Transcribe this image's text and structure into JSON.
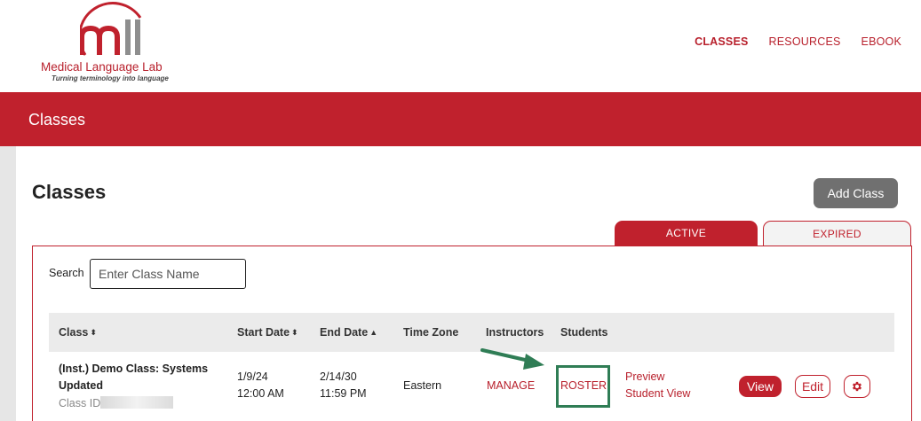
{
  "brand": {
    "name": "Medical Language Lab",
    "tagline": "Turning terminology into language",
    "primary_color": "#c0212d",
    "logo_letters": "mll"
  },
  "nav": {
    "items": [
      {
        "label": "CLASSES",
        "active": true
      },
      {
        "label": "RESOURCES",
        "active": false
      },
      {
        "label": "EBOOK",
        "active": false
      }
    ]
  },
  "banner": {
    "title": "Classes"
  },
  "main": {
    "title": "Classes",
    "add_button": "Add Class",
    "tabs": [
      {
        "label": "ACTIVE",
        "active": true
      },
      {
        "label": "EXPIRED",
        "active": false
      }
    ],
    "search": {
      "label": "Search",
      "placeholder": "Enter Class Name",
      "value": ""
    }
  },
  "table": {
    "columns": [
      "Class",
      "Start Date",
      "End Date",
      "Time Zone",
      "Instructors",
      "Students"
    ],
    "sort_icons": {
      "class": "sort-both-icon",
      "start_date": "sort-both-icon",
      "end_date": "sort-asc-icon"
    },
    "rows": [
      {
        "class_name": "(Inst.) Demo Class: Systems Updated",
        "class_id_label": "Class ID:",
        "start_date": "1/9/24",
        "start_time": "12:00 AM",
        "end_date": "2/14/30",
        "end_time": "11:59 PM",
        "time_zone": "Eastern",
        "instructors_link": "MANAGE",
        "students_link": "ROSTER",
        "preview_line1": "Preview",
        "preview_line2": "Student View",
        "view_button": "View",
        "edit_button": "Edit",
        "settings_icon": "gear-icon"
      }
    ]
  },
  "annotation": {
    "arrow_color": "#2f7d55",
    "highlight_color": "#2f7d55"
  }
}
